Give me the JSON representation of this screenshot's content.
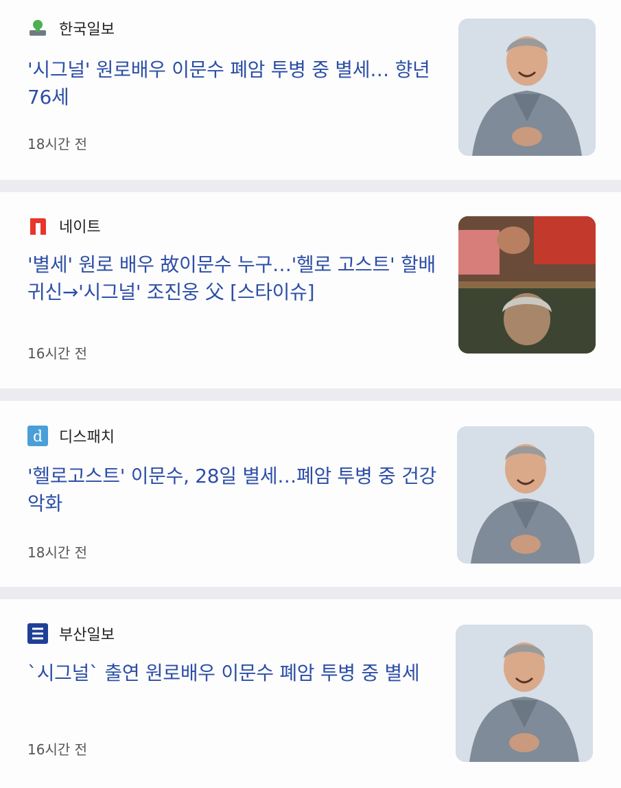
{
  "articles": [
    {
      "source": "한국일보",
      "source_icon": "hankook-ilbo-logo",
      "headline": "'시그널' 원로배우 이문수 폐암 투병 중 별세… 향년 76세",
      "time": "18시간 전",
      "thumbnail": "portrait-photo"
    },
    {
      "source": "네이트",
      "source_icon": "nate-logo",
      "headline": "'별세' 원로 배우 故이문수 누구…'헬로 고스트' 할배 귀신→'시그널' 조진웅 父 [스타이슈]",
      "time": "16시간 전",
      "thumbnail": "film-stills-photo"
    },
    {
      "source": "디스패치",
      "source_icon": "dispatch-logo",
      "headline": "'헬로고스트' 이문수, 28일 별세…폐암 투병 중 건강 악화",
      "time": "18시간 전",
      "thumbnail": "portrait-photo"
    },
    {
      "source": "부산일보",
      "source_icon": "busan-ilbo-logo",
      "headline": "`시그널` 출연 원로배우 이문수 폐암 투병 중 별세",
      "time": "16시간 전",
      "thumbnail": "portrait-photo"
    }
  ],
  "colors": {
    "headline": "#2c4ea5",
    "separator": "#ececf0",
    "time": "#555555"
  }
}
